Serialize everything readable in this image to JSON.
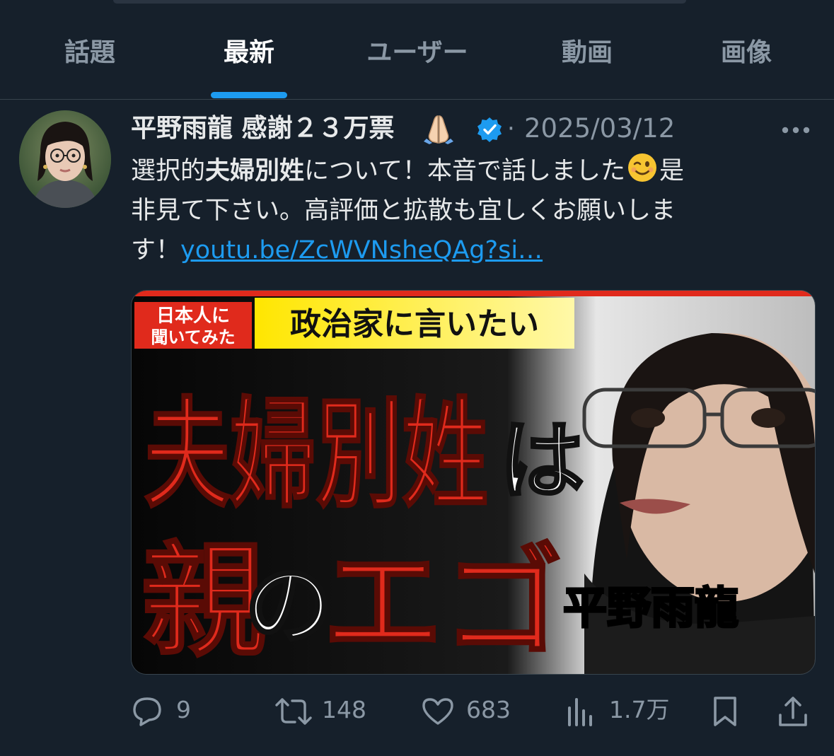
{
  "tabs": [
    {
      "label": "話題"
    },
    {
      "label": "最新"
    },
    {
      "label": "ユーザー"
    },
    {
      "label": "動画"
    },
    {
      "label": "画像"
    }
  ],
  "active_tab": "最新",
  "post": {
    "author": "平野雨龍 感謝２３万票",
    "separator": "·",
    "date": "2025/03/12",
    "text": {
      "l1_a": "選択的",
      "l1_b": "夫婦別姓",
      "l1_c": "について！本音で話しました",
      "l1_d": "是",
      "l2": "非見て下さい。高評価と拡散も宜しくお願いしま",
      "l3_a": "す！",
      "link": "youtu.be/ZcWVNsheQAg?si…"
    },
    "thumbnail": {
      "badge_top": "日本人に",
      "badge_bottom": "聞いてみた",
      "banner": "政治家に言いたい",
      "headline_1": "夫婦別姓",
      "headline_1_particle": "は",
      "headline_2_a": "親",
      "headline_2_particle": "の",
      "headline_2_b": "エゴ",
      "name_caption": "平野雨龍"
    },
    "stats": {
      "replies": "9",
      "reposts": "148",
      "likes": "683",
      "views": "1.7万"
    }
  },
  "colors": {
    "background": "#16202b",
    "accent": "#1d9bf0",
    "muted": "#8b98a5",
    "headline_red": "#e02a1c",
    "banner_yellow": "#ffe600"
  },
  "icons": {
    "emoji_1": "folded-hands-icon",
    "emoji_2": "winking-face-icon",
    "verified": "verified-badge-icon",
    "more": "more-icon",
    "reply": "reply-icon",
    "repost": "repost-icon",
    "like": "heart-icon",
    "views": "views-icon",
    "bookmark": "bookmark-icon",
    "share": "share-icon"
  }
}
